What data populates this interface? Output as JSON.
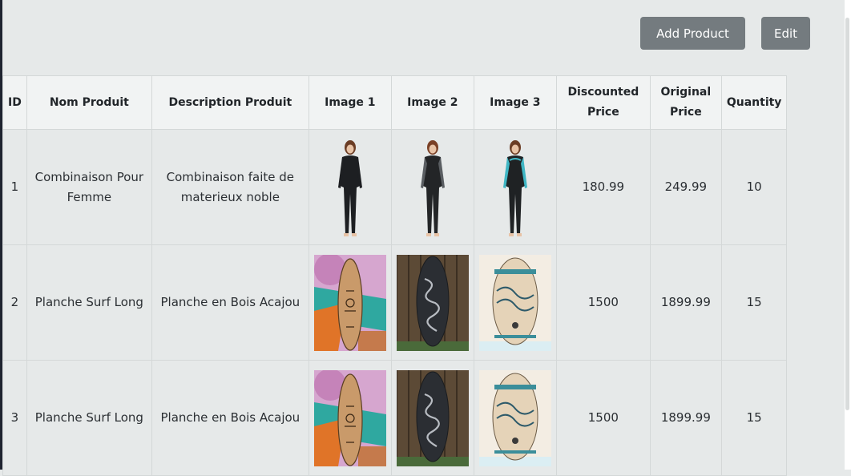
{
  "toolbar": {
    "add_label": "Add Product",
    "edit_label": "Edit"
  },
  "table": {
    "headers": [
      "ID",
      "Nom Produit",
      "Description Produit",
      "Image 1",
      "Image 2",
      "Image 3",
      "Discounted Price",
      "Original Price",
      "Quantity"
    ],
    "rows": [
      {
        "id": "1",
        "name": "Combinaison Pour Femme",
        "description": "Combinaison faite de materieux noble",
        "images": [
          "wetsuit-black-front",
          "wetsuit-grey-panels",
          "wetsuit-teal-panels"
        ],
        "discounted_price": "180.99",
        "original_price": "249.99",
        "quantity": "10"
      },
      {
        "id": "2",
        "name": "Planche Surf Long",
        "description": "Planche en Bois Acajou",
        "images": [
          "surfboard-mural",
          "surfboard-dark-wave",
          "surfboard-light-wave"
        ],
        "discounted_price": "1500",
        "original_price": "1899.99",
        "quantity": "15"
      },
      {
        "id": "3",
        "name": "Planche Surf Long",
        "description": "Planche en Bois Acajou",
        "images": [
          "surfboard-mural",
          "surfboard-dark-wave",
          "surfboard-light-wave"
        ],
        "discounted_price": "1500",
        "original_price": "1899.99",
        "quantity": "15"
      }
    ]
  },
  "colors": {
    "page_bg": "#e6e9e9",
    "header_bg": "#f1f3f3",
    "button_bg": "#747b7f",
    "button_text": "#ffffff"
  }
}
